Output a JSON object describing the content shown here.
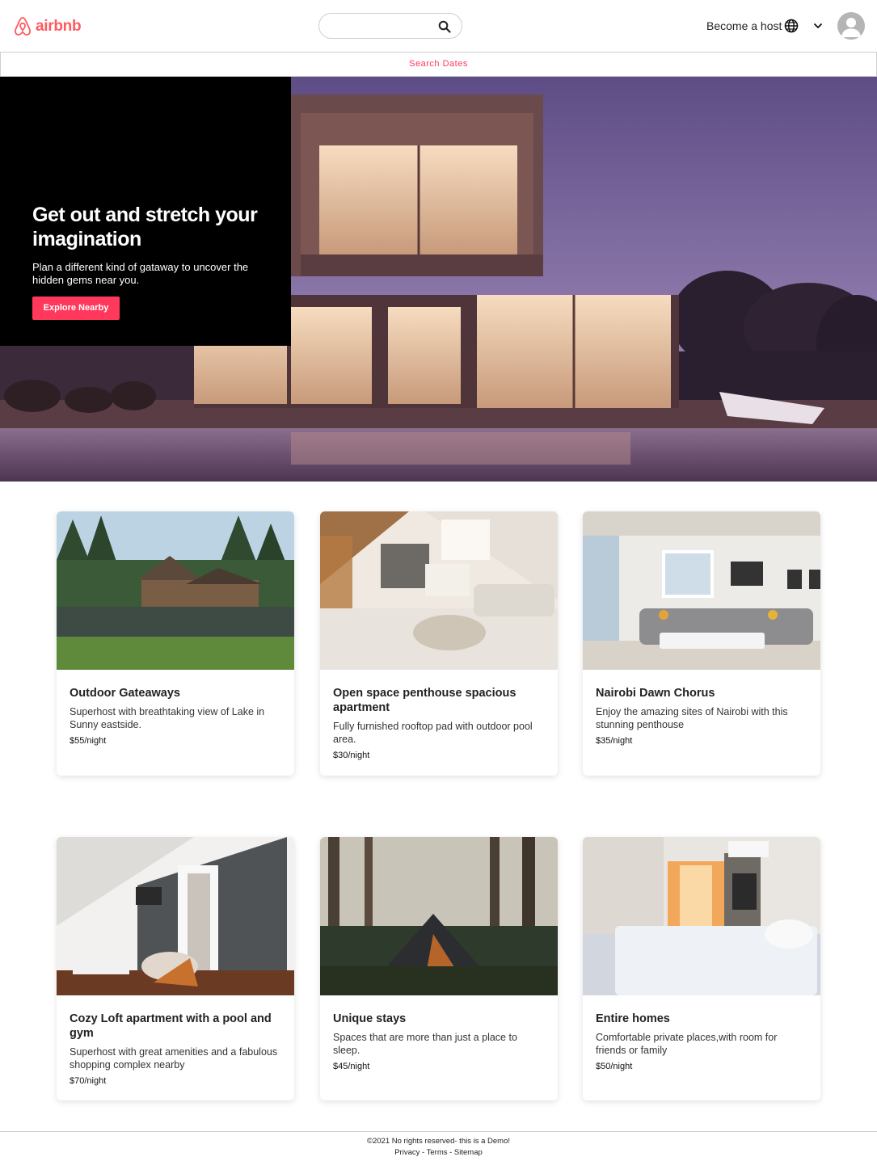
{
  "header": {
    "logo_text": "airbnb",
    "search_placeholder": "",
    "host_link": "Become a host"
  },
  "dates_bar": {
    "label": "Search Dates"
  },
  "hero": {
    "title": "Get out and stretch your imagination",
    "subtitle": "Plan a different kind of gataway to uncover the hidden gems near you.",
    "button_label": "Explore Nearby"
  },
  "cards": [
    {
      "title": "Outdoor Gateaways",
      "description": "Superhost with breathtaking view of Lake in Sunny eastside.",
      "price": "$55/night"
    },
    {
      "title": "Open space penthouse spacious apartment",
      "description": "Fully furnished rooftop pad with outdoor pool area.",
      "price": "$30/night"
    },
    {
      "title": "Nairobi Dawn Chorus",
      "description": "Enjoy the amazing sites of Nairobi with this stunning penthouse",
      "price": "$35/night"
    },
    {
      "title": "Cozy Loft apartment with a pool and gym",
      "description": "Superhost with great amenities and a fabulous shopping complex nearby",
      "price": "$70/night"
    },
    {
      "title": "Unique stays",
      "description": "Spaces that are more than just a place to sleep.",
      "price": "$45/night"
    },
    {
      "title": "Entire homes",
      "description": "Comfortable private places,with room for friends or family",
      "price": "$50/night"
    }
  ],
  "footer": {
    "copyright": "©2021 No rights reserved- this is a Demo!",
    "links": "Privacy - Terms - Sitemap"
  },
  "colors": {
    "brand": "#ff5a5f",
    "accent": "#ff385c"
  },
  "icons": [
    "airbnb-logo-icon",
    "search-icon",
    "globe-icon",
    "chevron-down-icon",
    "user-avatar-icon"
  ]
}
